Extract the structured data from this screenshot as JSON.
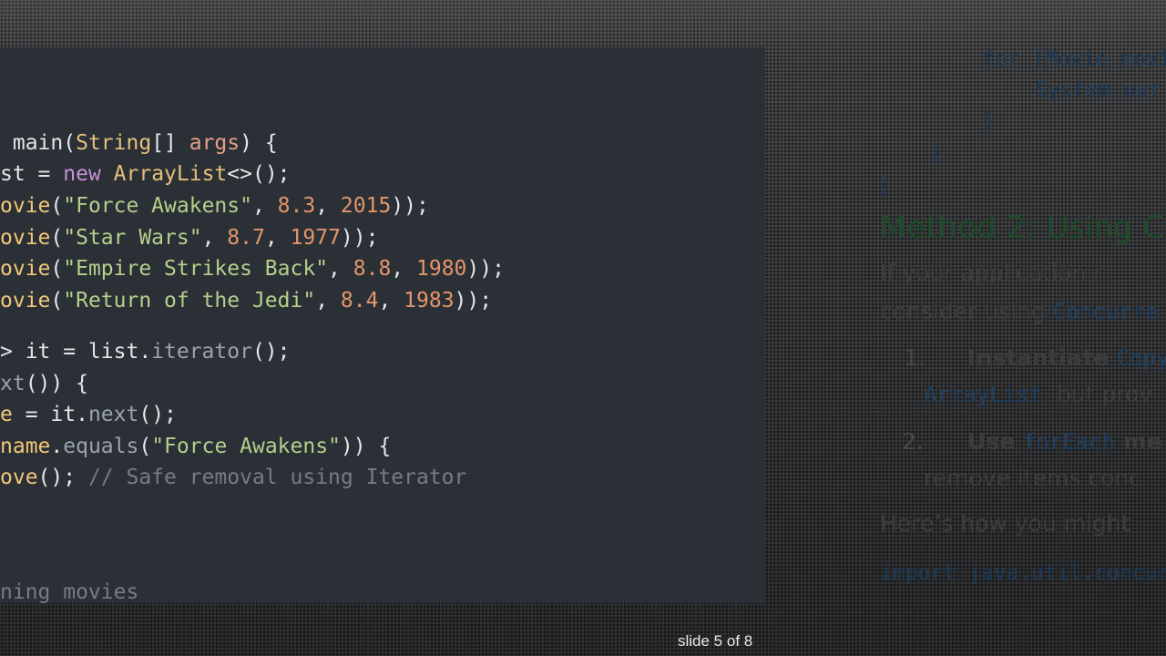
{
  "code": {
    "line1": {
      "a": " main(",
      "b": "String",
      "c": "[] ",
      "d": "args",
      "e": ") {"
    },
    "line2": {
      "a": "st = ",
      "b": "new",
      "c": " ",
      "d": "ArrayList",
      "e": "<>();"
    },
    "line3": {
      "a": "ovie",
      "b": "(",
      "c": "\"Force Awakens\"",
      "d": ", ",
      "e": "8.3",
      "f": ", ",
      "g": "2015",
      "h": "));"
    },
    "line4": {
      "a": "ovie",
      "b": "(",
      "c": "\"Star Wars\"",
      "d": ", ",
      "e": "8.7",
      "f": ", ",
      "g": "1977",
      "h": "));"
    },
    "line5": {
      "a": "ovie",
      "b": "(",
      "c": "\"Empire Strikes Back\"",
      "d": ", ",
      "e": "8.8",
      "f": ", ",
      "g": "1980",
      "h": "));"
    },
    "line6": {
      "a": "ovie",
      "b": "(",
      "c": "\"Return of the Jedi\"",
      "d": ", ",
      "e": "8.4",
      "f": ", ",
      "g": "1983",
      "h": "));"
    },
    "line7": {
      "a": "> it = list.",
      "b": "iterator",
      "c": "();"
    },
    "line8": {
      "a": "xt",
      "b": "()) {"
    },
    "line9": {
      "a": "e",
      "b": " = it.",
      "c": "next",
      "d": "();"
    },
    "line10": {
      "a": "name",
      "b": ".",
      "c": "equals",
      "d": "(",
      "e": "\"Force Awakens\"",
      "f": ")) {"
    },
    "line11": {
      "a": "ove",
      "b": "(); ",
      "c": "// Safe removal using Iterator"
    },
    "line12": {
      "a": "ning movies"
    }
  },
  "doc": {
    "code1": "for (Movie movi",
    "code2": "System.out.",
    "code3": "}",
    "code4": "}",
    "code5": "}",
    "heading": "Method 2: Using Co",
    "para1": "If your application r",
    "para2_a": "consider using ",
    "para2_b": "Concurre",
    "item1_num": "1.",
    "item1_bold": "Instantiate ",
    "item1_code": "Copy",
    "item1b_code": "ArrayList",
    "item1b_text": ", but prov",
    "item2_num": "2.",
    "item2_bold": "Use ",
    "item2_code": "forEach",
    "item2_bold2": " me",
    "item2b_text": "remove items conc",
    "para3": "Here’s how you might",
    "code_import": "import java.util.concur"
  },
  "footer": {
    "slide_counter": "slide 5 of 8"
  }
}
